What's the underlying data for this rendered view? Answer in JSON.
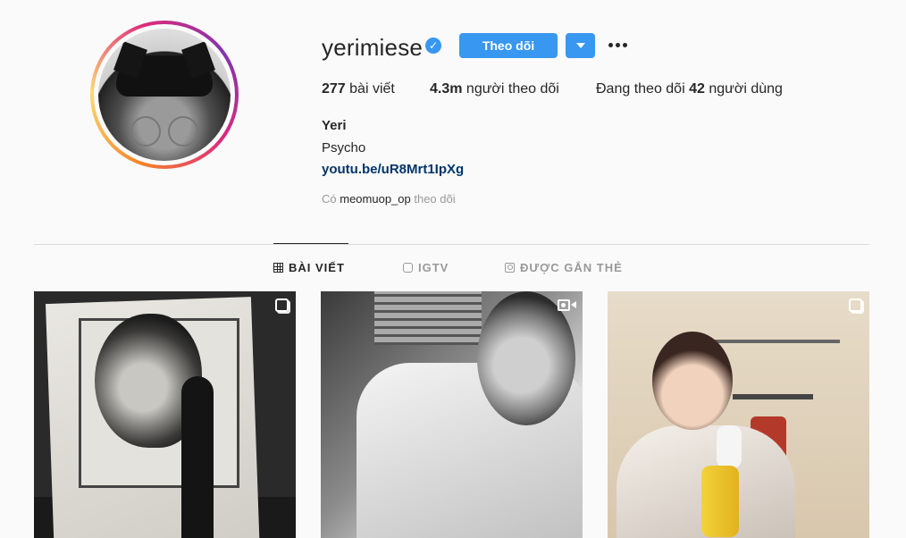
{
  "profile": {
    "username": "yerimiese",
    "verified_symbol": "✓",
    "follow_label": "Theo dõi",
    "stats": {
      "posts_count": "277",
      "posts_label": " bài viết",
      "followers_count": "4.3m",
      "followers_label": " người theo dõi",
      "following_prefix": "Đang theo dõi ",
      "following_count": "42",
      "following_label": " người dùng"
    },
    "full_name": "Yeri",
    "bio": "Psycho",
    "link": "youtu.be/uR8Mrt1IpXg",
    "followed_by_prefix": "Có ",
    "followed_by_user": "meomuop_op",
    "followed_by_suffix": " theo dõi"
  },
  "tabs": [
    {
      "label": "BÀI VIẾT",
      "icon": "grid-icon",
      "active": true
    },
    {
      "label": "IGTV",
      "icon": "tv-icon",
      "active": false
    },
    {
      "label": "ĐƯỢC GẮN THẺ",
      "icon": "tag-icon",
      "active": false
    }
  ],
  "posts": [
    {
      "type": "multi",
      "badge_icon": "carousel-icon"
    },
    {
      "type": "video",
      "badge_icon": "video-icon"
    },
    {
      "type": "multi",
      "badge_icon": "carousel-icon"
    }
  ],
  "colors": {
    "primary_blue": "#3897f0",
    "link_color": "#003569",
    "background": "#fafafa"
  }
}
